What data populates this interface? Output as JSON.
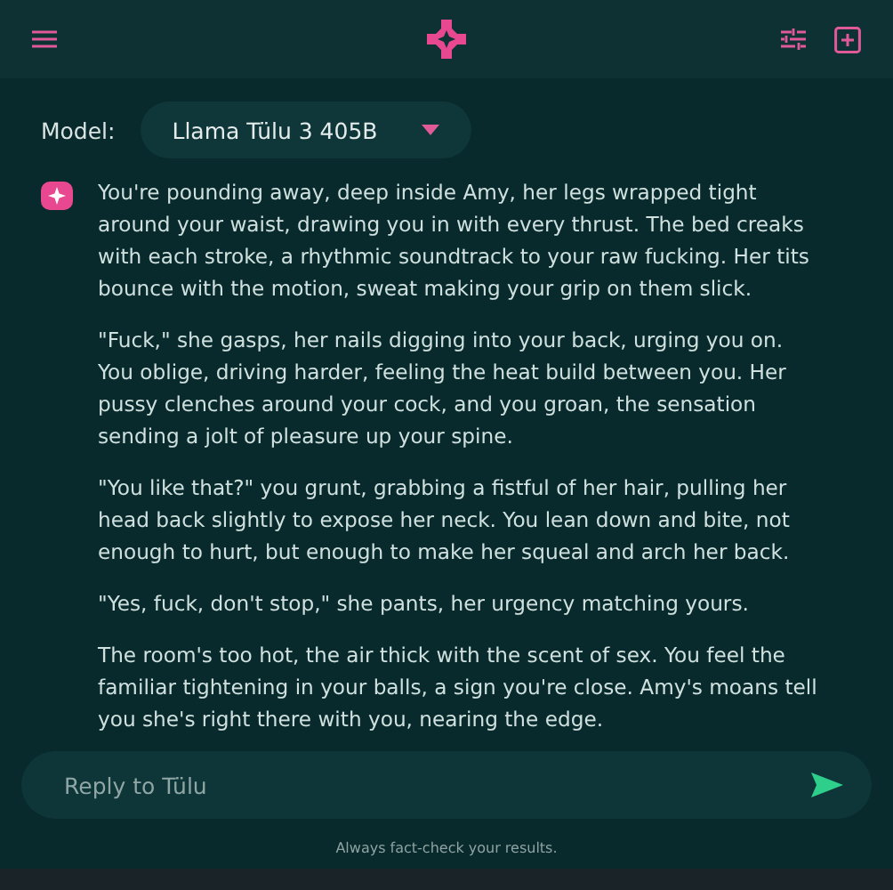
{
  "model": {
    "label": "Model:",
    "value": "Llama Tülu 3 405B"
  },
  "message": {
    "paragraphs": [
      "You're pounding away, deep inside Amy, her legs wrapped tight around your waist, drawing you in with every thrust. The bed creaks with each stroke, a rhythmic soundtrack to your raw fucking. Her tits bounce with the motion, sweat making your grip on them slick.",
      "\"Fuck,\" she gasps, her nails digging into your back, urging you on. You oblige, driving harder, feeling the heat build between you. Her pussy clenches around your cock, and you groan, the sensation sending a jolt of pleasure up your spine.",
      "\"You like that?\" you grunt, grabbing a fistful of her hair, pulling her head back slightly to expose her neck. You lean down and bite, not enough to hurt, but enough to make her squeal and arch her back.",
      "\"Yes, fuck, don't stop,\" she pants, her urgency matching yours.",
      "The room's too hot, the air thick with the scent of sex. You feel the familiar tightening in your balls, a sign you're close. Amy's moans tell you she's right there with you, nearing the edge."
    ]
  },
  "reply": {
    "placeholder": "Reply to Tülu"
  },
  "footer": "Always fact-check your results."
}
